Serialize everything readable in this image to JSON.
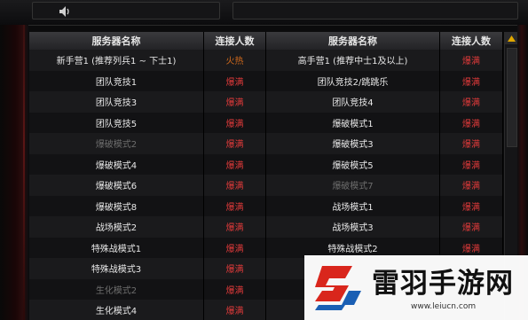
{
  "header": {
    "server_name_label": "服务器名称",
    "connections_label": "连接人数"
  },
  "rows": [
    {
      "left": {
        "name": "新手营1 (推荐列兵1 ~ 下士1)",
        "status": "火热"
      },
      "right": {
        "name": "高手营1 (推荐中士1及以上)",
        "status": "爆满"
      }
    },
    {
      "left": {
        "name": "团队竞技1",
        "status": "爆满"
      },
      "right": {
        "name": "团队竞技2/跳跳乐",
        "status": "爆满"
      }
    },
    {
      "left": {
        "name": "团队竞技3",
        "status": "爆满"
      },
      "right": {
        "name": "团队竞技4",
        "status": "爆满"
      }
    },
    {
      "left": {
        "name": "团队竞技5",
        "status": "爆满"
      },
      "right": {
        "name": "爆破模式1",
        "status": "爆满"
      }
    },
    {
      "left": {
        "name": "爆破模式2",
        "status": "爆满"
      },
      "right": {
        "name": "爆破模式3",
        "status": "爆满"
      }
    },
    {
      "left": {
        "name": "爆破模式4",
        "status": "爆满"
      },
      "right": {
        "name": "爆破模式5",
        "status": "爆满"
      }
    },
    {
      "left": {
        "name": "爆破模式6",
        "status": "爆满"
      },
      "right": {
        "name": "爆破模式7",
        "status": "爆满"
      }
    },
    {
      "left": {
        "name": "爆破模式8",
        "status": "爆满"
      },
      "right": {
        "name": "战场模式1",
        "status": "爆满"
      }
    },
    {
      "left": {
        "name": "战场模式2",
        "status": "爆满"
      },
      "right": {
        "name": "战场模式3",
        "status": "爆满"
      }
    },
    {
      "left": {
        "name": "特殊战模式1",
        "status": "爆满"
      },
      "right": {
        "name": "特殊战模式2",
        "status": "爆满"
      }
    },
    {
      "left": {
        "name": "特殊战模式3",
        "status": "爆满"
      },
      "right": {
        "name": "",
        "status": ""
      }
    },
    {
      "left": {
        "name": "生化模式2",
        "status": "爆满"
      },
      "right": {
        "name": "",
        "status": ""
      }
    },
    {
      "left": {
        "name": "生化模式4",
        "status": "爆满"
      },
      "right": {
        "name": "",
        "status": ""
      }
    }
  ],
  "watermark": {
    "title": "雷羽手游网",
    "url": "www.leiucn.com"
  },
  "icons": {
    "volume": "speaker-icon",
    "scroll_up": "arrow-up-icon",
    "logo": "leiyu-logo-icon"
  },
  "colors": {
    "status_full": "#e03a3a",
    "status_hot": "#d26a1c",
    "watermark_red": "#d9261c",
    "watermark_blue": "#1a5fb4"
  }
}
